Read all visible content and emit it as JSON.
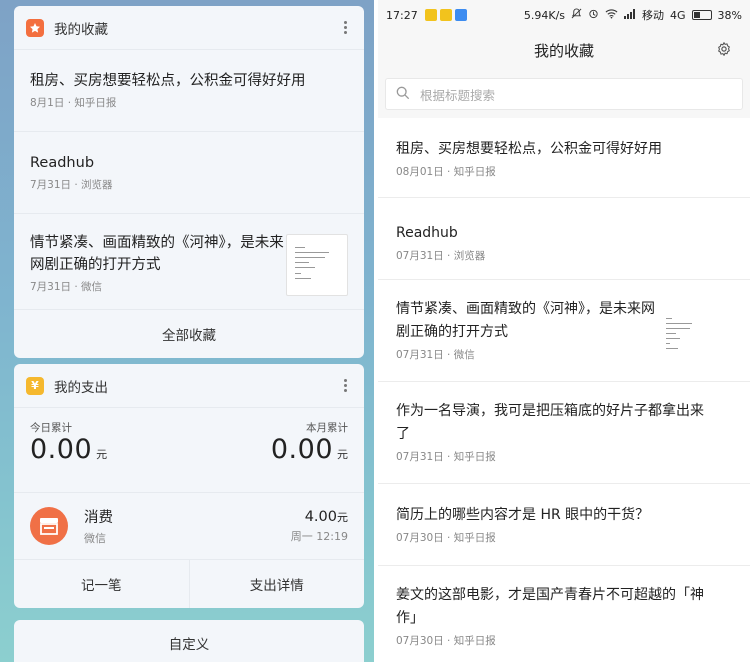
{
  "left": {
    "favorites": {
      "title": "我的收藏",
      "icon": "star-icon",
      "accent": "#f36f3f",
      "items": [
        {
          "title": "租房、买房想要轻松点，公积金可得好好用",
          "meta": "8月1日 · 知乎日报"
        },
        {
          "title": "Readhub",
          "meta": "7月31日 · 浏览器"
        },
        {
          "title_line1": "情节紧凑、画面精致的《河神》，是未来",
          "title_line2": "网剧正确的打开方式",
          "meta": "7月31日 · 微信"
        }
      ],
      "all_label": "全部收藏"
    },
    "expenses": {
      "title": "我的支出",
      "icon": "yen-icon",
      "accent": "#f5b82e",
      "today_label": "今日累计",
      "today_amount": "0.00",
      "month_label": "本月累计",
      "month_amount": "0.00",
      "unit": "元",
      "entry": {
        "name": "消费",
        "source": "微信",
        "amount": "4.00",
        "unit": "元",
        "time": "周一 12:19"
      },
      "record_label": "记一笔",
      "detail_label": "支出详情"
    },
    "customize_label": "自定义"
  },
  "right": {
    "status": {
      "time": "17:27",
      "speed": "5.94K/s",
      "carrier": "移动",
      "network": "4G",
      "battery": "38%",
      "battery_level": 0.38
    },
    "header": {
      "title": "我的收藏"
    },
    "search": {
      "placeholder": "根据标题搜索"
    },
    "items": [
      {
        "title": "租房、买房想要轻松点，公积金可得好好用",
        "meta": "08月01日 · 知乎日报"
      },
      {
        "title": "Readhub",
        "meta": "07月31日 · 浏览器"
      },
      {
        "title_line1": "情节紧凑、画面精致的《河神》，是未来网",
        "title_line2": "剧正确的打开方式",
        "meta": "07月31日 · 微信"
      },
      {
        "title_line1": "作为一名导演，我可是把压箱底的好片子都拿出来",
        "title_line2": "了",
        "meta": "07月31日 · 知乎日报"
      },
      {
        "title": "简历上的哪些内容才是 HR 眼中的干货？",
        "meta": "07月30日 · 知乎日报"
      },
      {
        "title_line1": "姜文的这部电影，才是国产青春片不可超越的「神",
        "title_line2": "作」",
        "meta": "07月30日 · 知乎日报"
      }
    ]
  }
}
